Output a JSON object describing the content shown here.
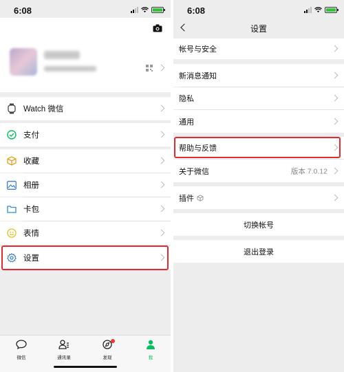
{
  "status_bar": {
    "time": "6:08"
  },
  "left_screen": {
    "menu": [
      {
        "label": "Watch 微信",
        "icon": "watch-icon"
      },
      {
        "label": "支付",
        "icon": "pay-icon"
      },
      {
        "label": "收藏",
        "icon": "favorites-icon"
      },
      {
        "label": "相册",
        "icon": "album-icon"
      },
      {
        "label": "卡包",
        "icon": "card-wallet-icon"
      },
      {
        "label": "表情",
        "icon": "sticker-icon"
      },
      {
        "label": "设置",
        "icon": "settings-gear-icon"
      }
    ],
    "tabs": [
      {
        "label": "微信",
        "icon": "chat-bubble-icon"
      },
      {
        "label": "通讯录",
        "icon": "contacts-icon"
      },
      {
        "label": "发现",
        "icon": "compass-icon"
      },
      {
        "label": "我",
        "icon": "person-icon",
        "active": true
      }
    ]
  },
  "right_screen": {
    "title": "设置",
    "items": [
      {
        "label": "帐号与安全"
      },
      {
        "label": "新消息通知"
      },
      {
        "label": "隐私"
      },
      {
        "label": "通用"
      },
      {
        "label": "帮助与反馈"
      },
      {
        "label": "关于微信",
        "value": "版本 7.0.12"
      },
      {
        "label": "插件"
      }
    ],
    "switch_account": "切换帐号",
    "logout": "退出登录"
  },
  "colors": {
    "accent_green": "#07c160",
    "highlight_red": "#e8272f",
    "background": "#ededed"
  }
}
